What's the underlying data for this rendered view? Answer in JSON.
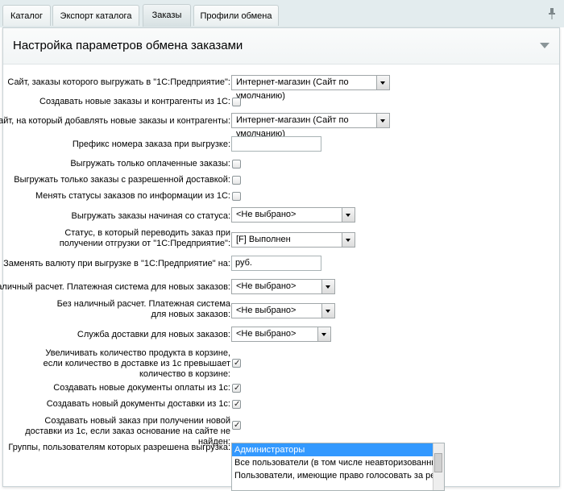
{
  "tabs": [
    {
      "label": "Каталог",
      "active": false
    },
    {
      "label": "Экспорт каталога",
      "active": false
    },
    {
      "label": "Заказы",
      "active": true
    },
    {
      "label": "Профили обмена",
      "active": false
    }
  ],
  "panel": {
    "title": "Настройка параметров обмена заказами"
  },
  "fields": {
    "site_export": {
      "label": "Сайт, заказы которого выгружать в \"1С:Предприятие\":",
      "value": "Интернет-магазин (Сайт по умолчанию)"
    },
    "create_orders": {
      "label": "Создавать новые заказы и контрагенты из 1С:",
      "checked": false
    },
    "site_add": {
      "label": "Сайт, на который добавлять новые заказы и контрагенты:",
      "value": "Интернет-магазин (Сайт по умолчанию)"
    },
    "prefix": {
      "label": "Префикс номера заказа при выгрузке:",
      "value": ""
    },
    "only_paid": {
      "label": "Выгружать только оплаченные заказы:",
      "checked": false
    },
    "only_allowed_delivery": {
      "label": "Выгружать только заказы с разрешенной доставкой:",
      "checked": false
    },
    "change_statuses": {
      "label": "Менять статусы заказов по информации из 1С:",
      "checked": false
    },
    "from_status": {
      "label": "Выгружать заказы начиная со статуса:",
      "value": "<Не выбрано>"
    },
    "status_on_receive": {
      "label": "Статус, в который переводить заказ при получении отгрузки от \"1С:Предприятие\":",
      "value": "[F] Выполнен"
    },
    "currency": {
      "label": "Заменять валюту при выгрузке в \"1С:Предприятие\" на:",
      "value": "руб."
    },
    "cash_pay": {
      "label": "Наличный расчет. Платежная система для новых заказов:",
      "value": "<Не выбрано>"
    },
    "noncash_pay": {
      "label": "Без наличный расчет. Платежная система для новых заказов:",
      "value": "<Не выбрано>"
    },
    "delivery": {
      "label": "Служба доставки для новых заказов:",
      "value": "<Не выбрано>"
    },
    "increase_qty": {
      "label": "Увеличивать количество продукта в корзине, если количество в доставке из 1с превышает количество в корзине:",
      "checked": true
    },
    "create_payment_docs": {
      "label": "Создавать новые документы оплаты из 1с:",
      "checked": true
    },
    "create_delivery_docs": {
      "label": "Создавать новый документы доставки из 1с:",
      "checked": true
    },
    "create_order_on_delivery": {
      "label": "Создавать новый заказ при получении новой доставки из 1с, если заказ основание на сайте не найден:",
      "checked": true
    },
    "groups": {
      "label": "Группы, пользователям которых разрешена выгрузка:",
      "options": [
        {
          "label": "Администраторы",
          "selected": true
        },
        {
          "label": "Все пользователи (в том числе неавторизованные)",
          "selected": false
        },
        {
          "label": "Пользователи, имеющие право голосовать за рейтинг",
          "selected": false
        }
      ]
    }
  },
  "colors": {
    "selected_option": "#3399ff",
    "tabs_bg": "#e3ecee"
  }
}
